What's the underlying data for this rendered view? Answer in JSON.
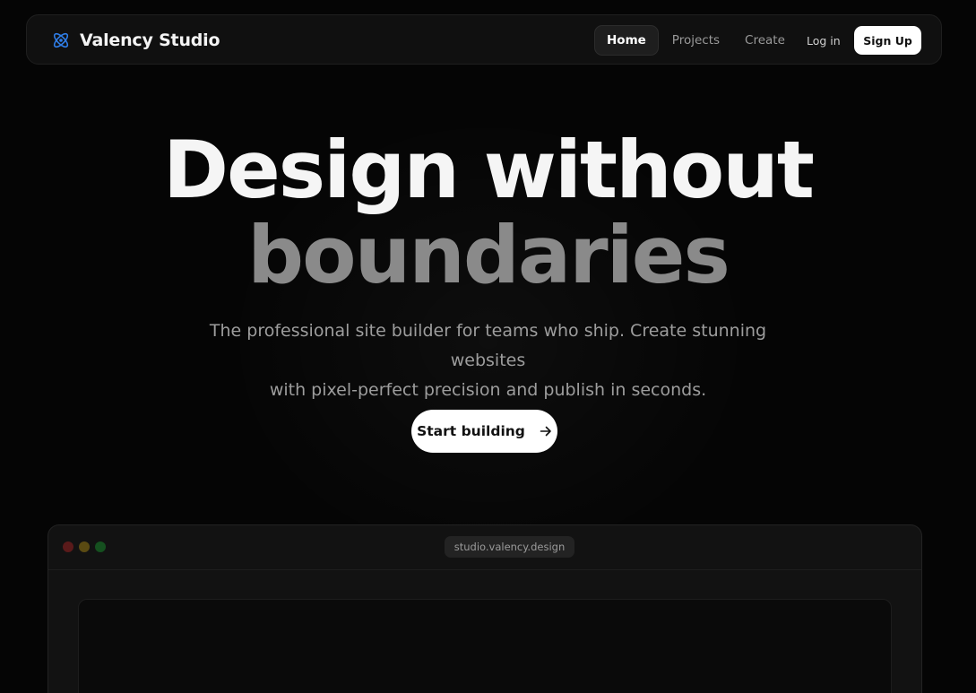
{
  "brand": {
    "name": "Valency Studio",
    "icon": "atom-icon",
    "icon_color": "#2f7ee8"
  },
  "nav": {
    "items": [
      {
        "label": "Home",
        "active": true
      },
      {
        "label": "Projects",
        "active": false
      },
      {
        "label": "Create",
        "active": false
      }
    ],
    "login_label": "Log in",
    "signup_label": "Sign Up"
  },
  "hero": {
    "line1": "Design without",
    "line2": "boundaries",
    "subtitle_line1": "The professional site builder for teams who ship. Create stunning websites",
    "subtitle_line2": "with pixel-perfect precision and publish in seconds.",
    "cta_label": "Start building",
    "cta_icon": "arrow-right-icon"
  },
  "preview": {
    "url": "studio.valency.design",
    "dot_colors": [
      "#5a1a1a",
      "#5a4a12",
      "#15501f"
    ]
  },
  "colors": {
    "background": "#050505",
    "text_primary": "#f5f5f5",
    "text_muted": "#8a8a8a",
    "accent": "#2f7ee8"
  }
}
